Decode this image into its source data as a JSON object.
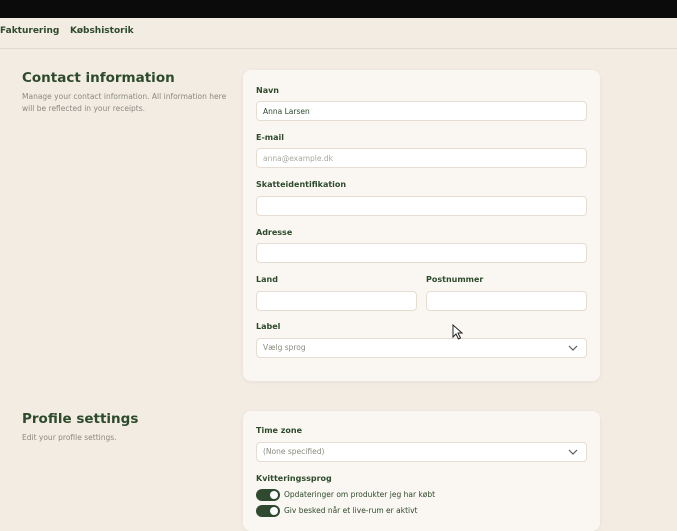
{
  "nav": {
    "items": [
      "Fakturering",
      "Købshistorik"
    ]
  },
  "contact": {
    "title": "Contact information",
    "description": "Manage your contact information. All information here will be reflected in your receipts.",
    "fields": {
      "name_label": "Navn",
      "name_value": "Anna Larsen",
      "email_label": "E-mail",
      "email_placeholder": "anna@example.dk",
      "tax_label": "Skatteidentifikation",
      "address_label": "Adresse",
      "country_label": "Land",
      "postal_label": "Postnummer",
      "label_label": "Label",
      "label_select": "Vælg sprog"
    }
  },
  "profile": {
    "title": "Profile settings",
    "description": "Edit your profile settings.",
    "timezone_label": "Time zone",
    "timezone_value": "(None specified)",
    "receipt_lang_label": "Kvitteringssprog",
    "toggles": [
      {
        "label": "Opdateringer om produkter jeg har købt",
        "on": true
      },
      {
        "label": "Giv besked når et live-rum er aktivt",
        "on": true
      }
    ]
  },
  "colors": {
    "accent": "#2f4a2f",
    "background": "#f3ece3",
    "card": "#faf7f2"
  },
  "icons": {
    "select": "chevron-down-icon",
    "pointer": "mouse-cursor-icon"
  }
}
